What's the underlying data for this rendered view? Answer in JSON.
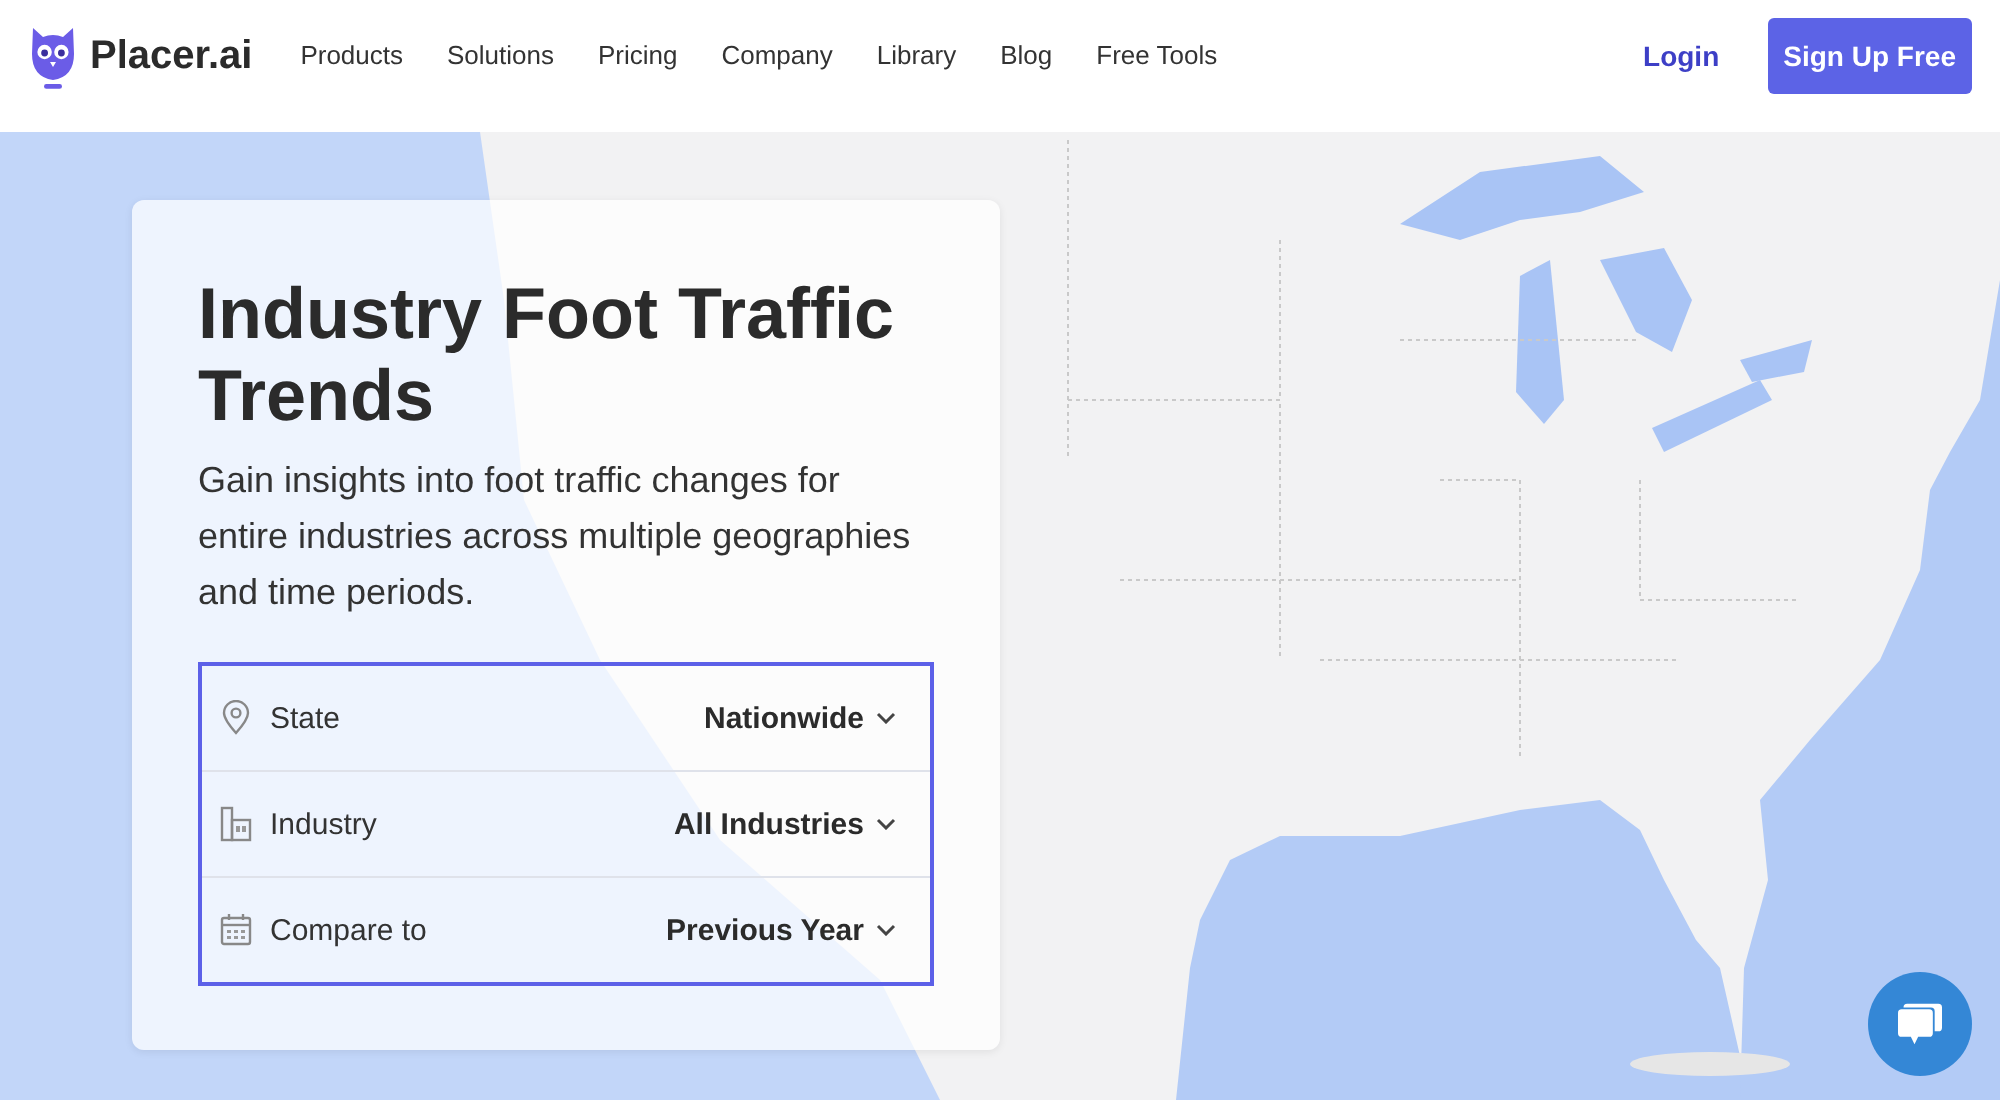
{
  "header": {
    "logo": "Placer.ai",
    "nav": [
      "Products",
      "Solutions",
      "Pricing",
      "Company",
      "Library",
      "Blog",
      "Free Tools"
    ],
    "login": "Login",
    "signup": "Sign Up Free"
  },
  "hero": {
    "title": "Industry Foot Traffic Trends",
    "subtitle": "Gain insights into foot traffic changes for entire industries across multiple geographies and time periods.",
    "filters": [
      {
        "label": "State",
        "value": "Nationwide"
      },
      {
        "label": "Industry",
        "value": "All Industries"
      },
      {
        "label": "Compare to",
        "value": "Previous Year"
      }
    ]
  }
}
